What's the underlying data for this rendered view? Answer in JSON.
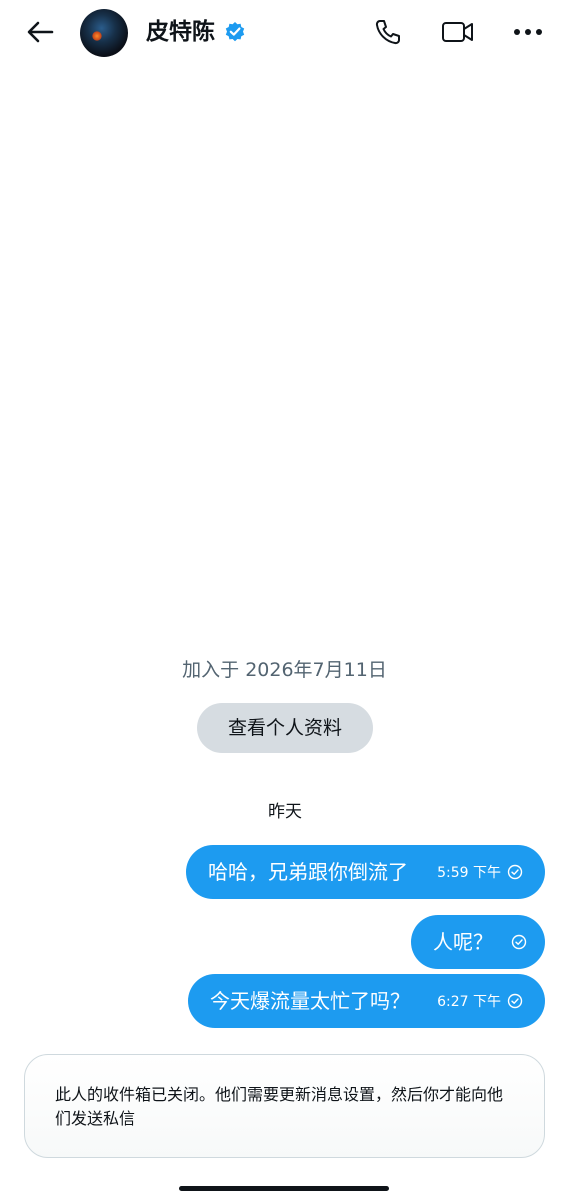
{
  "header": {
    "contact_name": "皮特陈",
    "verified": true
  },
  "conversation": {
    "joined_text": "加入于 2026年7月11日",
    "view_profile_label": "查看个人资料",
    "day_separator": "昨天",
    "messages": [
      {
        "text": "哈哈，兄弟跟你倒流了",
        "time": "5:59 下午",
        "status": "sent"
      },
      {
        "text": "人呢？",
        "time": "",
        "status": "sent"
      },
      {
        "text": "今天爆流量太忙了吗？",
        "time": "6:27 下午",
        "status": "sent"
      }
    ]
  },
  "notice": {
    "text": "此人的收件箱已关闭。他们需要更新消息设置，然后你才能向他们发送私信"
  },
  "colors": {
    "accent": "#1d9bf0",
    "button_gray": "#d6dce1",
    "muted_text": "#536471"
  },
  "icons": [
    "back-arrow-icon",
    "verified-badge-icon",
    "phone-icon",
    "video-camera-icon",
    "more-icon",
    "check-circle-icon"
  ]
}
